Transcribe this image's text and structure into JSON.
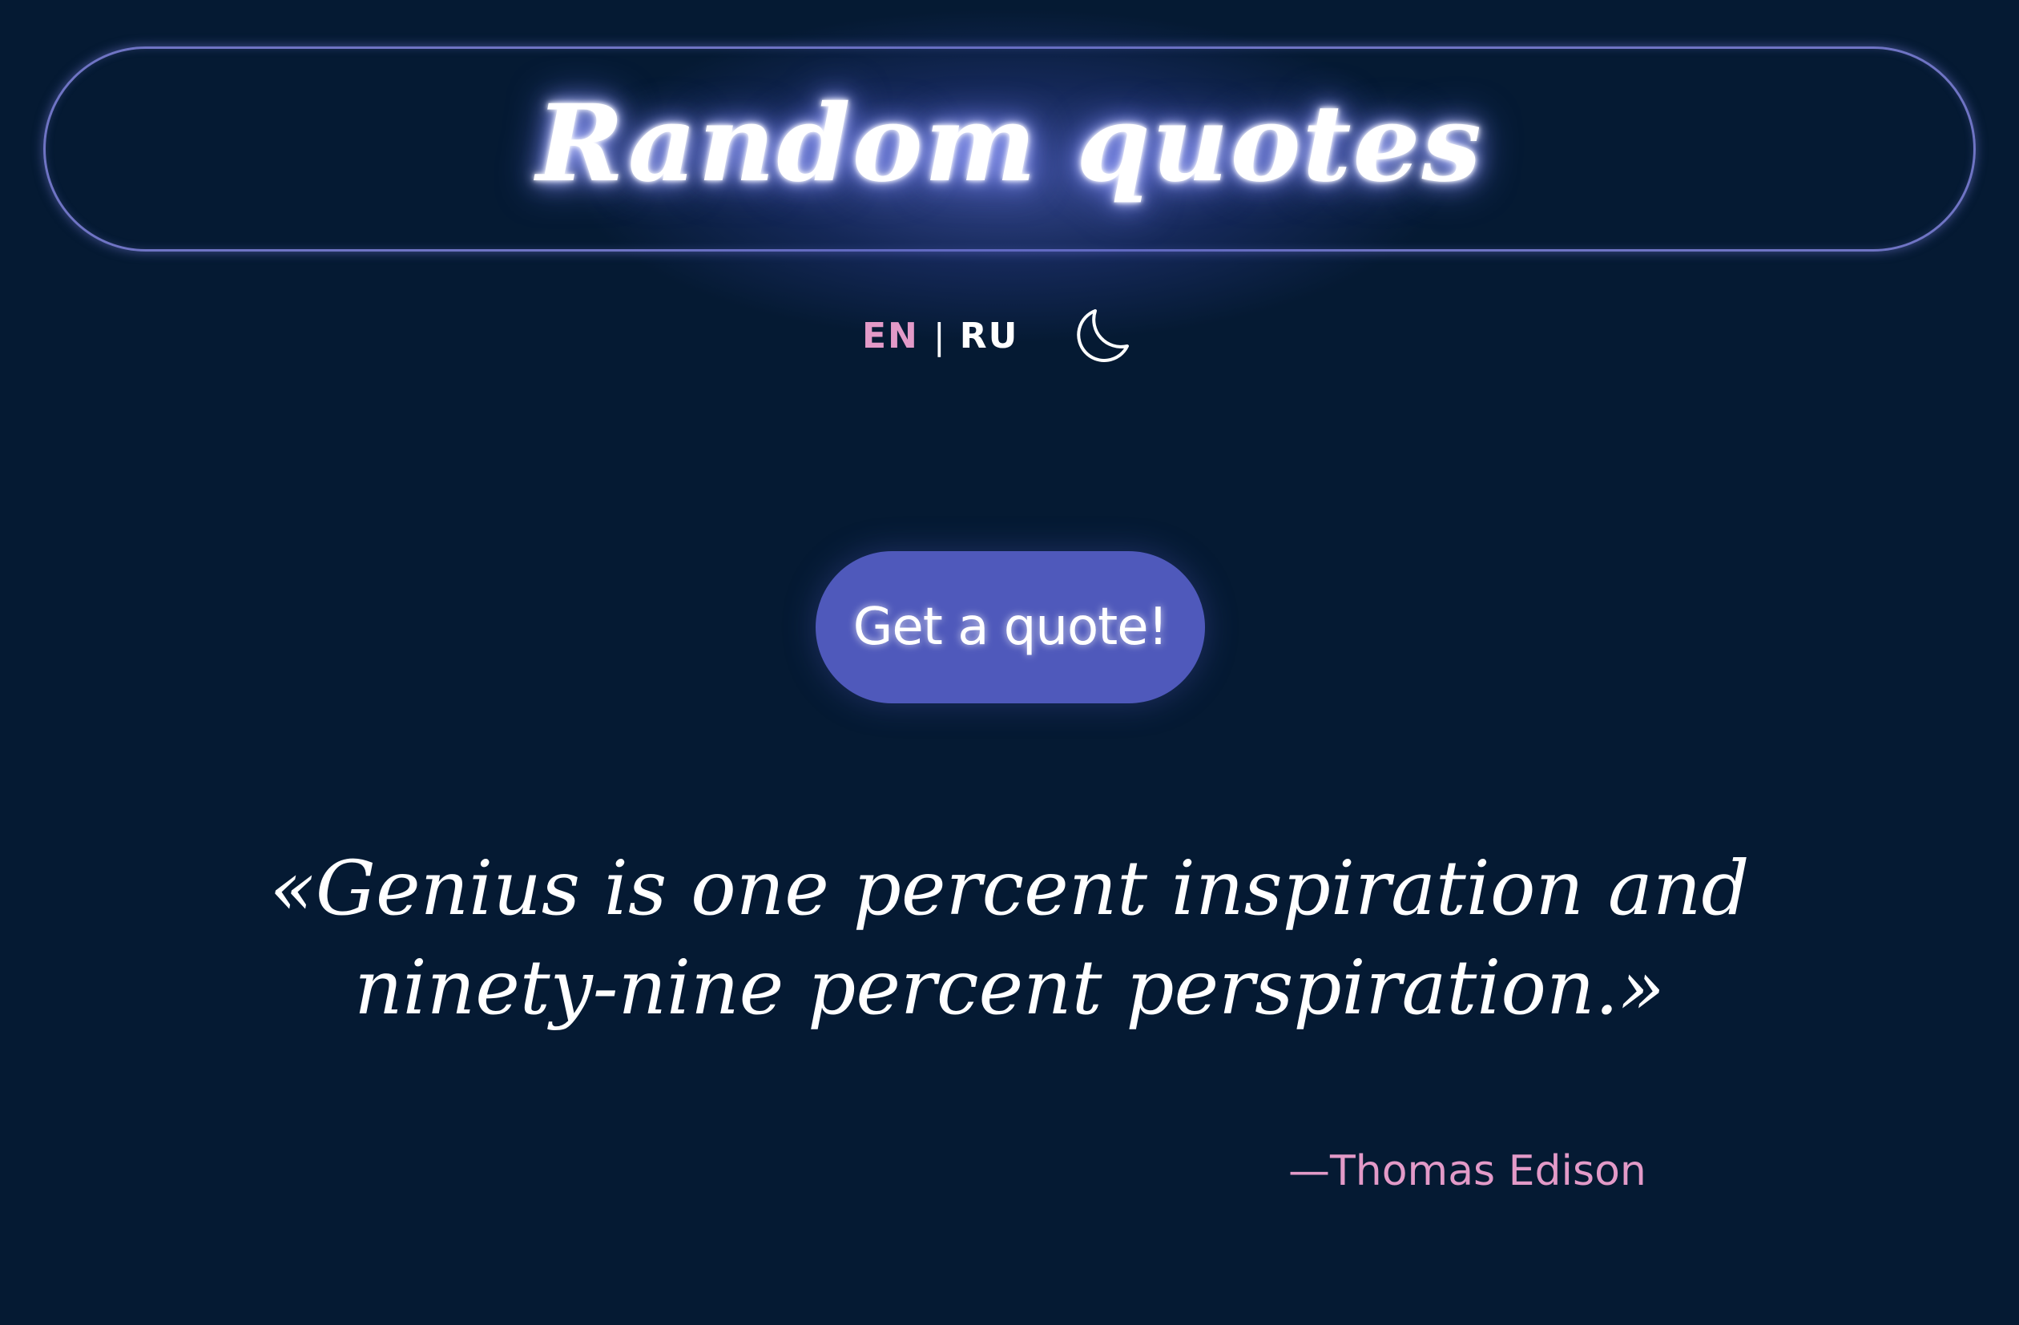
{
  "header": {
    "title": "Random quotes"
  },
  "controls": {
    "lang_en": "EN",
    "lang_separator": "|",
    "lang_ru": "RU",
    "active_lang": "EN",
    "theme_icon": "moon-icon"
  },
  "main": {
    "button_label": "Get a quote!",
    "quote_text": "«Genius is one percent inspiration and ninety-nine percent perspiration.»",
    "author": "—Thomas Edison"
  },
  "colors": {
    "background": "#051a33",
    "accent_pink": "#e39ac8",
    "button": "#4f59bb",
    "border_glow": "#6f74c4"
  }
}
